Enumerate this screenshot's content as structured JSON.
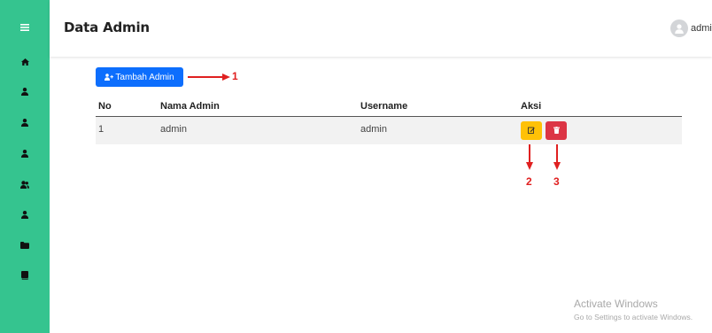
{
  "sidebar": {
    "items": [
      {
        "icon": "menu-icon"
      },
      {
        "icon": "home-icon"
      },
      {
        "icon": "user-icon"
      },
      {
        "icon": "user-icon"
      },
      {
        "icon": "user-icon"
      },
      {
        "icon": "users-icon"
      },
      {
        "icon": "user-icon"
      },
      {
        "icon": "folder-icon"
      },
      {
        "icon": "book-icon"
      }
    ],
    "color": "#35c48f"
  },
  "header": {
    "title": "Data Admin",
    "user_name": "admin"
  },
  "toolbar": {
    "add_label": "Tambah Admin",
    "add_color": "#0d6efd"
  },
  "table": {
    "headers": [
      "No",
      "Nama Admin",
      "Username",
      "Aksi"
    ],
    "rows": [
      {
        "no": "1",
        "nama": "admin",
        "username": "admin"
      }
    ],
    "edit_color": "#ffc107",
    "delete_color": "#dc3545"
  },
  "annotations": [
    "1",
    "2",
    "3"
  ],
  "watermark": {
    "line1": "Activate Windows",
    "line2": "Go to Settings to activate Windows."
  }
}
